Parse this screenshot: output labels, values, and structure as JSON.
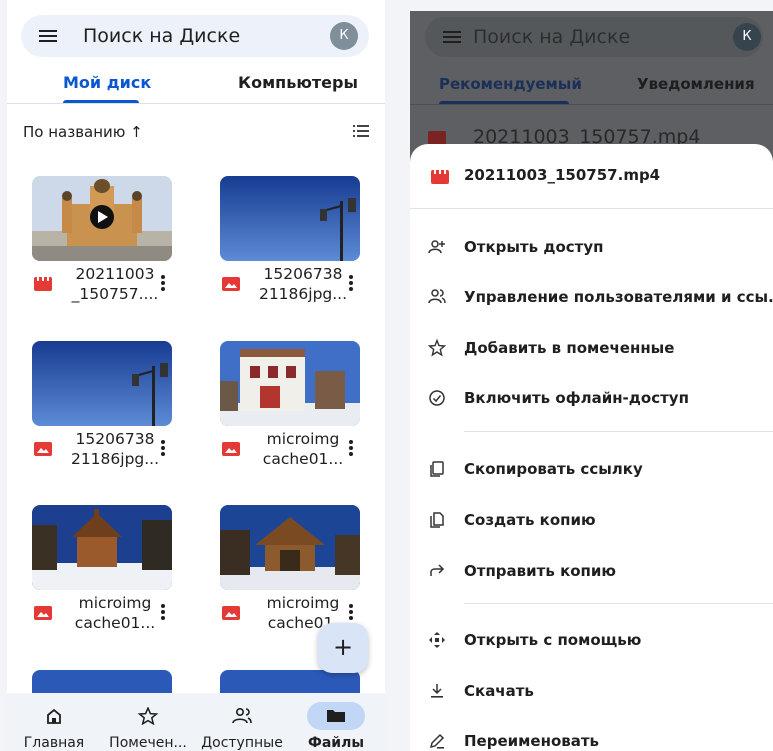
{
  "left": {
    "search_placeholder": "Поиск на Диске",
    "avatar_letter": "К",
    "tabs": [
      {
        "label": "Мой диск",
        "active": true
      },
      {
        "label": "Компьютеры",
        "active": false
      }
    ],
    "sort_label": "По названию ↑",
    "files": [
      {
        "line1": "20211003",
        "line2": "_150757....",
        "type": "video",
        "thumb": "church"
      },
      {
        "line1": "15206738",
        "line2": "21186jpg...",
        "type": "image",
        "thumb": "lamp"
      },
      {
        "line1": "15206738",
        "line2": "21186jpg...",
        "type": "image",
        "thumb": "lamp"
      },
      {
        "line1": "microimg",
        "line2": "cache01...",
        "type": "image",
        "thumb": "building"
      },
      {
        "line1": "microimg",
        "line2": "cache01...",
        "type": "image",
        "thumb": "chapel"
      },
      {
        "line1": "microimg",
        "line2": "cache01.",
        "type": "image",
        "thumb": "gazebo"
      }
    ],
    "fab_label": "+",
    "bottom_nav": [
      {
        "label": "Главная",
        "icon": "home-icon",
        "active": false
      },
      {
        "label": "Помечен...",
        "icon": "star-icon",
        "active": false
      },
      {
        "label": "Доступные",
        "icon": "people-icon",
        "active": false
      },
      {
        "label": "Файлы",
        "icon": "folder-icon",
        "active": true
      }
    ]
  },
  "right": {
    "search_placeholder": "Поиск на Диске",
    "avatar_letter": "К",
    "tabs": [
      {
        "label": "Рекомендуемый",
        "active": true
      },
      {
        "label": "Уведомления",
        "active": false
      }
    ],
    "background_row": "20211003_150757.mp4",
    "sheet": {
      "title": "20211003_150757.mp4",
      "groups": [
        [
          {
            "label": "Открыть доступ",
            "icon": "person-add-icon"
          },
          {
            "label": "Управление пользователями и ссы...",
            "icon": "manage-people-icon"
          },
          {
            "label": "Добавить в помеченные",
            "icon": "star-icon"
          },
          {
            "label": "Включить офлайн-доступ",
            "icon": "offline-icon"
          }
        ],
        [
          {
            "label": "Скопировать ссылку",
            "icon": "copy-link-icon"
          },
          {
            "label": "Создать копию",
            "icon": "copy-icon"
          },
          {
            "label": "Отправить копию",
            "icon": "send-icon"
          }
        ],
        [
          {
            "label": "Открыть с помощью",
            "icon": "open-with-icon"
          },
          {
            "label": "Скачать",
            "icon": "download-icon"
          },
          {
            "label": "Переименовать",
            "icon": "rename-icon"
          }
        ]
      ]
    }
  },
  "colors": {
    "accent": "#0b57d0",
    "video_red": "#e53935",
    "nav_active_pill": "#c2d7f6",
    "overlay_bg": "#5d5f62"
  }
}
